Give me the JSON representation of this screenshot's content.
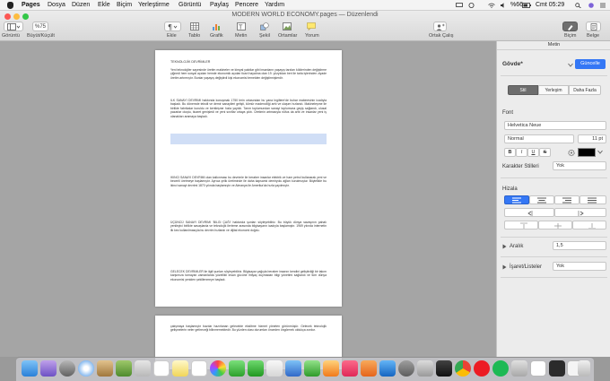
{
  "menubar": {
    "app": "Pages",
    "items": [
      "Dosya",
      "Düzen",
      "Ekle",
      "Biçim",
      "Yerleştirme",
      "Görüntü",
      "Paylaş",
      "Pencere",
      "Yardım"
    ],
    "battery": "%66",
    "clock": "Cmt 05:29"
  },
  "window": {
    "title": "MODERN WORLD ECONOMY.pages — Düzenlendi",
    "view_label": "Görüntü",
    "zoom_value": "%75",
    "zoom_label": "Büyüt/Küçült",
    "toolbar": [
      "Ekle",
      "Tablo",
      "Grafik",
      "Metin",
      "Şekil",
      "Ortamlar",
      "Yorum"
    ],
    "collaborate": "Ortak Çalış",
    "format": "Biçim",
    "document": "Belge"
  },
  "document": {
    "page1_title": "TEKNOLOJİK DEVRİMLER",
    "p1": "Yeni teknolojiler sayesinde üretim makineler ve kimyal yakıtlar gibi insanların yaşayış tarzları köklerinden değiştirme çiğnedi hem sosyal açıdan hemde ekonomik açıdan ticari hayatına olan 19. yüzyıldan beri ile tarla işlerinden ziyade üretim artırmıştır. Bunlar yaşayış değiştirdi kişi ekonomisi temelden değiştirmişlerdir.",
    "p2": "İLK SANAYİ DEVRİMİ hakkında konuşmak 1750 lerin ortasından bu yana İngiltere'de buhar makinesinin icadıyla başladı. Bu dönemde tekstil ve demir sanayileri gelişti, kömür madenciliği arttı ve ulaşım hızlandı. Makineleşme ile birlikte fabrikalar kuruldu ve kentleşme hızla yayıldı. Tarım toplumundan sanayi toplumuna geçiş sağlandı, ulusal pazarlar oluştu, ticaret genişledi ve yeni sınıflar ortaya çıktı. Üretimin artmasıyla nüfus da arttı ve insanlar yeni iş olanakları aramaya başladı.",
    "p3": "İKİNCİ SANAYİ DEVRİMİ olan kalkınması bu devrimle ile beraber insanlar elektrik ve ham petrol kullanarak yeni ve becerili üretmeye başlamıştır. Ayrıca çelik üretiminde ile daha kapsamlı demiryolu ağları kurulmuştur. Böylelikle bu ikinci sanayi devrimi 1870 yılında başlamıştır ve Almanya ile Amerika'da hızla yayılmıştır.",
    "p4": "ÜÇÜNCÜ SANAYİ DEVRİMİ 'BİLGİ ÇAĞI' hakkında şunları söyleyebiliriz. Bu büyük dünya savaşının pahalı yenileyici birlikte savaşlarda ve teknolojik ilerleme arasında bilgisayarın icadıyla başlamıştır. 1969 yılında internetin ilk kez kullanılmasıyla bu devrim hızlandı ve dijital ekonomi doğdu.",
    "p5": "GELECEK DEVRİMLER ile ilgili şunları söyleyebiliriz. Bilgisayar çağıyla beraber insanın kendini geliştirdiği bir takım karşımıza tomayan zamanlarda yüzellikli insan gücüne ihtiyaç duymadan bilgi yönetimi sağlandı ve tüm dünya ekonomisi yeniden şekillenmeye başladı.",
    "p6": "çalışmaya başlamıştır bazılar hazırlanan gelecekte eksiltme hizmet yöneten görünmüşür. Gelecek teknolojik gelişmelerin neler getireceği bilinmemektedir. Bu yüzden olası durumları önceden öngörmek oldukça zordur."
  },
  "inspector": {
    "header": "Metin",
    "style_name": "Gövde*",
    "update_button": "Güncelle",
    "tabs": [
      "Stil",
      "Yerleşim",
      "Daha Fazla"
    ],
    "font_label": "Font",
    "font_family": "Helvetica Neue",
    "font_style": "Normal",
    "font_size": "11 pt",
    "bold": "B",
    "italic": "I",
    "underline": "U",
    "strike": "S",
    "char_styles_label": "Karakter Stilleri",
    "char_styles_value": "Yok",
    "align_label": "Hizala",
    "spacing_label": "Aralık",
    "spacing_value": "1,5",
    "lists_label": "İşaret/Listeler",
    "lists_value": "Yok"
  },
  "colors": {
    "accent": "#3477f5",
    "highlight": "#ffff66"
  }
}
